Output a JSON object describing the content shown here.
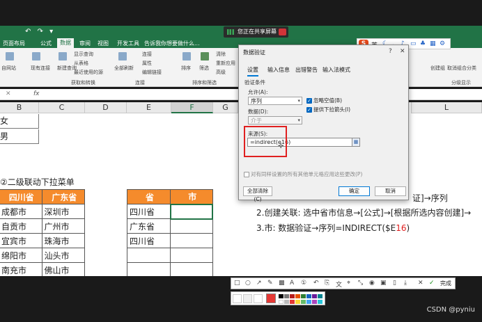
{
  "titlebar": {
    "share_text": "您正在共享屏幕"
  },
  "ribbon_tabs": [
    {
      "label": "页面布局"
    },
    {
      "label": "公式"
    },
    {
      "label": "数据"
    },
    {
      "label": "审阅"
    },
    {
      "label": "视图"
    },
    {
      "label": "开发工具"
    },
    {
      "label": "告诉我你想要做什么..."
    }
  ],
  "ribbon": {
    "items": [
      "全部刷新",
      "显示查询",
      "从表格",
      "最近使用的源",
      "新建查询",
      "连接",
      "属性",
      "编辑链接",
      "排序",
      "筛选",
      "清除",
      "重新应用",
      "高级",
      "现有连接",
      "自网站"
    ],
    "groups": [
      "获取和转换",
      "连接",
      "排序和筛选",
      "分级显示"
    ],
    "right_items": [
      "创建组",
      "取消组合",
      "分类"
    ]
  },
  "formula_bar": {
    "fx": "fx",
    "cancel": "✕"
  },
  "columns": [
    "B",
    "C",
    "D",
    "E",
    "F",
    "G",
    "L"
  ],
  "sheet": {
    "left_cells": [
      "女",
      "男"
    ],
    "heading": "②二级联动下拉菜单",
    "table1": {
      "headers": [
        "四川省",
        "广东省"
      ],
      "rows": [
        [
          "成都市",
          "深圳市"
        ],
        [
          "自贡市",
          "广州市"
        ],
        [
          "宜宾市",
          "珠海市"
        ],
        [
          "绵阳市",
          "汕头市"
        ],
        [
          "南充市",
          "佛山市"
        ]
      ]
    },
    "table2": {
      "headers": [
        "省",
        "市"
      ],
      "rows": [
        [
          "四川省",
          ""
        ],
        [
          "广东省",
          ""
        ],
        [
          "四川省",
          ""
        ],
        [
          "",
          ""
        ],
        [
          "",
          ""
        ]
      ]
    },
    "steps": {
      "step1_tail": "证]→序列",
      "step2": "2.创建关联: 选中省市信息→[公式]→[根据所选内容创建]→",
      "step3_prefix": "3.市: 数据验证→序列=INDIRECT($E",
      "step3_red": "16",
      "step3_suffix": ")"
    }
  },
  "dialog": {
    "title": "数据验证",
    "help": "?",
    "close": "✕",
    "tabs": [
      "设置",
      "输入信息",
      "出错警告",
      "输入法模式"
    ],
    "section": "验证条件",
    "allow_label": "允许(A):",
    "allow_value": "序列",
    "ignore_blank": "忽略空值(B)",
    "dropdown": "提供下拉箭头(I)",
    "data_label": "数据(D):",
    "data_value": "介于",
    "source_label": "来源(S):",
    "source_value": "=indirect(e16)",
    "apply_all": "对有同样设置的所有其他单元格应用这些更改(P)",
    "clear_all": "全部清除(C)",
    "ok": "确定",
    "cancel": "取消"
  },
  "ime": {
    "brand": "S",
    "lang": "英"
  },
  "snapbar": {
    "done": "完成"
  },
  "watermark": "CSDN @pyniu"
}
